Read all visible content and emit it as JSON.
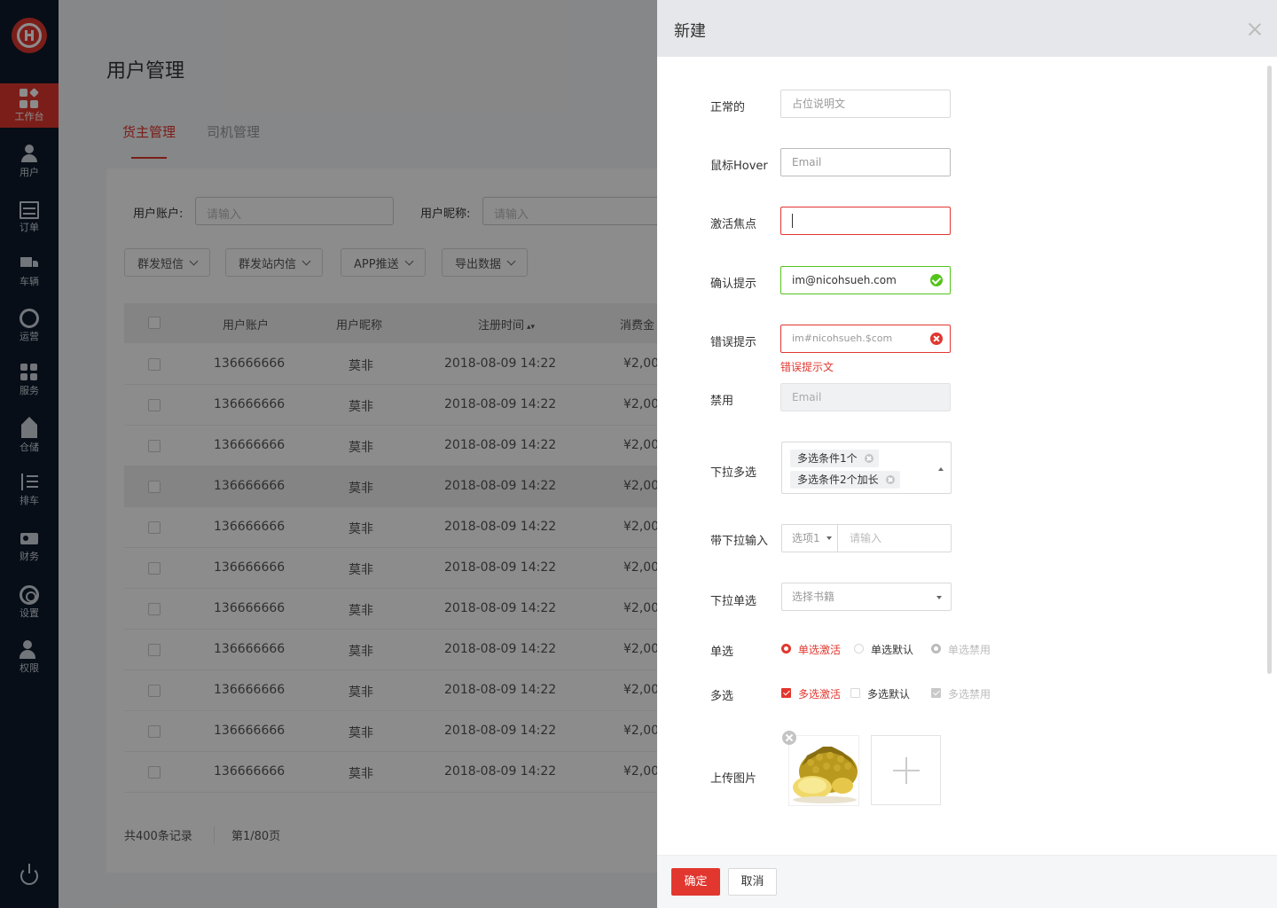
{
  "sidebar": {
    "items": [
      {
        "label": "工作台",
        "icon": "dashboard-icon"
      },
      {
        "label": "用户",
        "icon": "user-icon"
      },
      {
        "label": "订单",
        "icon": "order-icon"
      },
      {
        "label": "车辆",
        "icon": "truck-icon"
      },
      {
        "label": "运营",
        "icon": "operation-icon"
      },
      {
        "label": "服务",
        "icon": "service-icon"
      },
      {
        "label": "仓储",
        "icon": "warehouse-icon"
      },
      {
        "label": "排车",
        "icon": "schedule-icon"
      },
      {
        "label": "财务",
        "icon": "finance-icon"
      },
      {
        "label": "设置",
        "icon": "settings-icon"
      },
      {
        "label": "权限",
        "icon": "permission-icon"
      }
    ],
    "active_index": 0,
    "accent": "#e1372f",
    "background": "#0e1a2b"
  },
  "main": {
    "title": "用户管理",
    "tabs": [
      "货主管理",
      "司机管理"
    ],
    "filters": {
      "account_label": "用户账户:",
      "account_placeholder": "请输入",
      "nickname_label": "用户昵称:",
      "nickname_placeholder": "请输入"
    },
    "actions": [
      "群发短信",
      "群发站内信",
      "APP推送",
      "导出数据"
    ],
    "table": {
      "columns": [
        "用户账户",
        "用户昵称",
        "注册时间",
        "消费金"
      ],
      "rows": [
        {
          "account": "136666666",
          "nickname": "莫非",
          "time": "2018-08-09  14:22",
          "amount": "¥2,00"
        },
        {
          "account": "136666666",
          "nickname": "莫非",
          "time": "2018-08-09  14:22",
          "amount": "¥2,00"
        },
        {
          "account": "136666666",
          "nickname": "莫非",
          "time": "2018-08-09  14:22",
          "amount": "¥2,00"
        },
        {
          "account": "136666666",
          "nickname": "莫非",
          "time": "2018-08-09  14:22",
          "amount": "¥2,00"
        },
        {
          "account": "136666666",
          "nickname": "莫非",
          "time": "2018-08-09  14:22",
          "amount": "¥2,00"
        },
        {
          "account": "136666666",
          "nickname": "莫非",
          "time": "2018-08-09  14:22",
          "amount": "¥2,00"
        },
        {
          "account": "136666666",
          "nickname": "莫非",
          "time": "2018-08-09  14:22",
          "amount": "¥2,00"
        },
        {
          "account": "136666666",
          "nickname": "莫非",
          "time": "2018-08-09  14:22",
          "amount": "¥2,00"
        },
        {
          "account": "136666666",
          "nickname": "莫非",
          "time": "2018-08-09  14:22",
          "amount": "¥2,00"
        },
        {
          "account": "136666666",
          "nickname": "莫非",
          "time": "2018-08-09  14:22",
          "amount": "¥2,00"
        },
        {
          "account": "136666666",
          "nickname": "莫非",
          "time": "2018-08-09  14:22",
          "amount": "¥2,00"
        }
      ],
      "highlighted_row": 3
    },
    "pagination": {
      "total": "共400条记录",
      "page": "第1/80页"
    }
  },
  "drawer": {
    "title": "新建",
    "fields": {
      "normal": {
        "label": "正常的",
        "placeholder": "占位说明文"
      },
      "hover": {
        "label": "鼠标Hover",
        "placeholder": "Email"
      },
      "focus": {
        "label": "激活焦点",
        "value": ""
      },
      "confirm": {
        "label": "确认提示",
        "value": "im@nicohsueh.com"
      },
      "error": {
        "label": "错误提示",
        "value": "im#nicohsueh.$com",
        "message": "错误提示文"
      },
      "disabled": {
        "label": "禁用",
        "placeholder": "Email"
      },
      "multi_select": {
        "label": "下拉多选",
        "tags": [
          "多选条件1个",
          "多选条件2个加长"
        ]
      },
      "dropdown_input": {
        "label": "带下拉输入",
        "option": "选项1",
        "placeholder": "请输入"
      },
      "single_select": {
        "label": "下拉单选",
        "placeholder": "选择书籍"
      },
      "radio": {
        "label": "单选",
        "options": [
          "单选激活",
          "单选默认",
          "单选禁用"
        ],
        "selected": 0
      },
      "checkbox": {
        "label": "多选",
        "options": [
          "多选激活",
          "多选默认",
          "多选禁用"
        ],
        "checked": [
          0
        ]
      },
      "upload": {
        "label": "上传图片"
      }
    },
    "buttons": {
      "confirm": "确定",
      "cancel": "取消"
    }
  }
}
